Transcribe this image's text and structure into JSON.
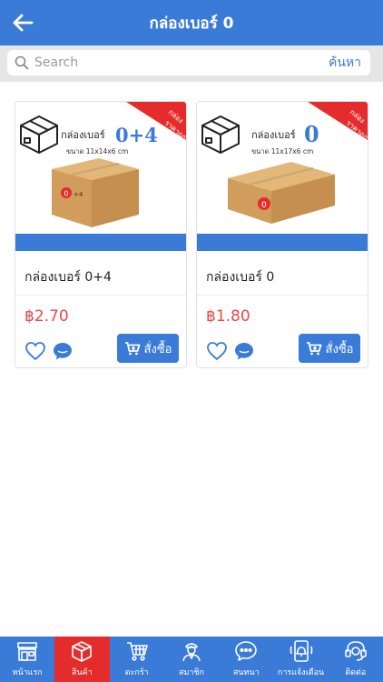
{
  "header": {
    "title": "กล่องเบอร์ 0"
  },
  "search": {
    "placeholder": "Search",
    "button_label": "ค้นหา"
  },
  "products": [
    {
      "name": "กล่องเบอร์ 0+4",
      "price": "฿2.70",
      "order_label": "สั่งซื้อ",
      "image": {
        "brand_text": "กล่องเบอร์",
        "number": "0+4",
        "size_text": "ขนาด 11x14x6 cm",
        "ribbon_top": "กล่อง",
        "ribbon_bottom": "ราคาถูก",
        "label_number": "0",
        "label_suffix": "+4"
      }
    },
    {
      "name": "กล่องเบอร์ 0",
      "price": "฿1.80",
      "order_label": "สั่งซื้อ",
      "image": {
        "brand_text": "กล่องเบอร์",
        "number": "0",
        "size_text": "ขนาด 11x17x6 cm",
        "ribbon_top": "กล่อง",
        "ribbon_bottom": "ราคาถูก",
        "label_number": "0",
        "label_suffix": ""
      }
    }
  ],
  "bottom_nav": [
    {
      "label": "หน้าแรก",
      "icon": "storefront-icon",
      "active": false
    },
    {
      "label": "สินค้า",
      "icon": "box-icon",
      "active": true
    },
    {
      "label": "ตะกร้า",
      "icon": "cart-icon",
      "active": false
    },
    {
      "label": "สมาชิก",
      "icon": "member-icon",
      "active": false
    },
    {
      "label": "สนทนา",
      "icon": "chat-icon",
      "active": false
    },
    {
      "label": "การแจ้งเตือน",
      "icon": "notification-icon",
      "active": false
    },
    {
      "label": "ติดต่อ",
      "icon": "headset-icon",
      "active": false
    }
  ],
  "colors": {
    "primary": "#3b7bd8",
    "active_tab": "#e52c2c",
    "price": "#e94848",
    "ribbon": "#e52c2c",
    "box": "#d6a665"
  }
}
